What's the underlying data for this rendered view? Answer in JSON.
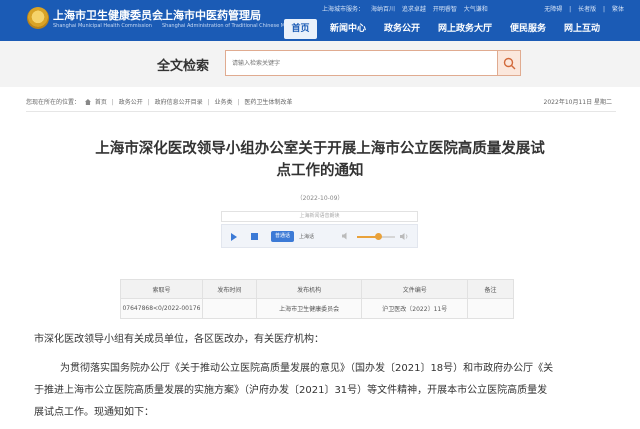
{
  "header": {
    "site_name": "上海市卫生健康委员会",
    "site_subtitle": "Shanghai Municipal Health Commission",
    "site_name_2": "上海市中医药管理局",
    "site_subtitle_2": "Shanghai Administration of Traditional Chinese Medicine",
    "top_links": [
      "上海城市服务：",
      "海纳百川",
      "追求卓越",
      "开明睿智",
      "大气谦和"
    ],
    "top_right_links": [
      "无障碍",
      "|",
      "长者版",
      "|",
      "繁体"
    ],
    "nav": [
      "首页",
      "新闻中心",
      "政务公开",
      "网上政务大厅",
      "便民服务",
      "网上互动"
    ],
    "active_nav": "首页",
    "brand_color": "#1b5bb5"
  },
  "search": {
    "title": "全文检索",
    "placeholder": "请输入检索关键字",
    "button_icon": "search-icon"
  },
  "breadcrumb": {
    "prefix": "您现在所在的位置：",
    "items": [
      "首页",
      "政务公开",
      "政府信息公开目录",
      "业务类",
      "医药卫生体制改革"
    ],
    "separator": "|",
    "date": "2022年10月11日 星期二"
  },
  "article": {
    "title": "上海市深化医改领导小组办公室关于开展上海市公立医院高质量发展试点工作的通知",
    "date": "（2022-10-09）"
  },
  "player": {
    "label": "上海新闻语音朗读",
    "speed": "普通话",
    "accent": "上海话",
    "volume": 0.55
  },
  "info_table": {
    "headers": [
      "索取号",
      "发布时间",
      "发布机构",
      "文件编号",
      "备注"
    ],
    "row": [
      "07647868<0/2022-00176",
      "",
      "上海市卫生健康委员会",
      "沪卫医改〔2022〕11号",
      ""
    ]
  },
  "body": {
    "p1": "市深化医改领导小组有关成员单位，各区医改办，有关医疗机构：",
    "p2": "为贯彻落实国务院办公厅《关于推动公立医院高质量发展的意见》（国办发〔2021〕18号）和市政府办公厅《关",
    "p3": "于推进上海市公立医院高质量发展的实施方案》（沪府办发〔2021〕31号）等文件精神，开展本市公立医院高质量发",
    "p4": "展试点工作。现通知如下："
  }
}
